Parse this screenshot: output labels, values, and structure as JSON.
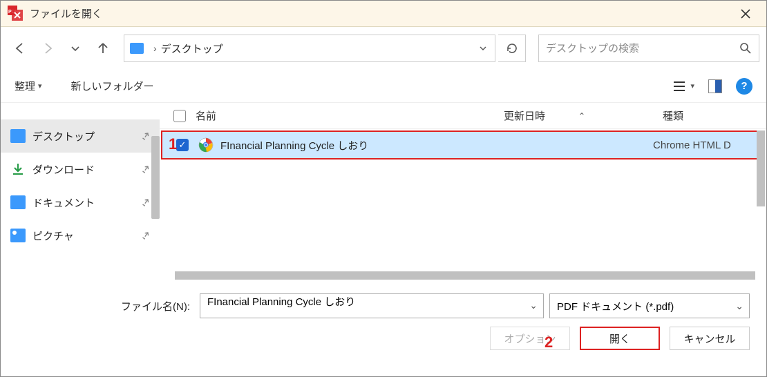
{
  "window": {
    "title": "ファイルを開く"
  },
  "nav": {
    "crumb": "デスクトップ",
    "search_placeholder": "デスクトップの検索"
  },
  "toolbar": {
    "organize": "整理",
    "new_folder": "新しいフォルダー"
  },
  "sidebar": {
    "items": [
      {
        "label": "デスクトップ"
      },
      {
        "label": "ダウンロード"
      },
      {
        "label": "ドキュメント"
      },
      {
        "label": "ピクチャ"
      }
    ]
  },
  "columns": {
    "name": "名前",
    "date": "更新日時",
    "type": "種類"
  },
  "files": [
    {
      "name": "FInancial Planning Cycle しおり",
      "type": "Chrome HTML D"
    }
  ],
  "footer": {
    "filename_label": "ファイル名(N):",
    "filename_value": "FInancial Planning Cycle しおり",
    "filter": "PDF ドキュメント (*.pdf)",
    "option": "オプション",
    "open": "開く",
    "cancel": "キャンセル"
  },
  "callouts": {
    "c1": "1",
    "c2": "2"
  }
}
